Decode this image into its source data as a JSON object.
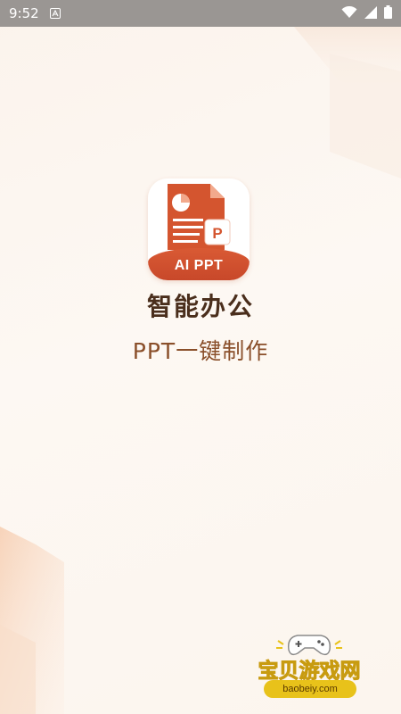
{
  "status_bar": {
    "time": "9:52",
    "notification_icon": "a-letter-icon",
    "wifi_icon": "wifi-icon",
    "signal_icon": "cell-signal-icon",
    "battery_icon": "battery-icon"
  },
  "splash": {
    "icon_label": "AI PPT",
    "title": "智能办公",
    "subtitle": "PPT一键制作"
  },
  "watermark": {
    "name": "宝贝游戏网",
    "url": "baobeiy.com"
  },
  "colors": {
    "accent": "#d4552f",
    "title": "#4a2e1c",
    "subtitle": "#8a4f2a",
    "status_bar": "#9a9693"
  }
}
